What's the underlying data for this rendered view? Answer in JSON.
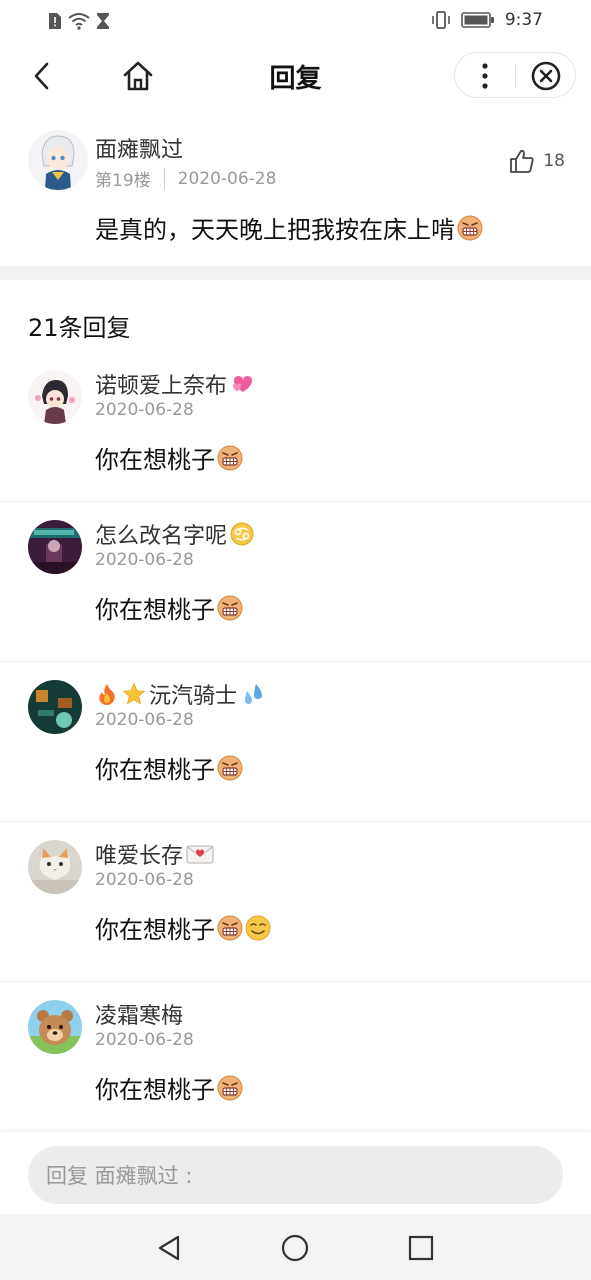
{
  "status_bar": {
    "time": "9:37"
  },
  "header": {
    "title": "回复"
  },
  "main_post": {
    "author": "面瘫飘过",
    "floor": "第19楼",
    "date": "2020-06-28",
    "likes": "18",
    "content": "是真的，天天晚上把我按在床上啃"
  },
  "reply_count": "21条回复",
  "replies": [
    {
      "name": "诺顿爱上奈布",
      "date": "2020-06-28",
      "content": "你在想桃子"
    },
    {
      "name": "怎么改名字呢",
      "date": "2020-06-28",
      "content": "你在想桃子"
    },
    {
      "name": "沅汽骑士",
      "date": "2020-06-28",
      "content": "你在想桃子"
    },
    {
      "name": "唯爱长存",
      "date": "2020-06-28",
      "content": "你在想桃子"
    },
    {
      "name": "凌霜寒梅",
      "date": "2020-06-28",
      "content": "你在想桃子"
    }
  ],
  "input": {
    "placeholder": "回复 面瘫飘过 :"
  },
  "colors": {
    "accent": "#222222",
    "muted": "#999999",
    "input_bg": "#ececec"
  }
}
